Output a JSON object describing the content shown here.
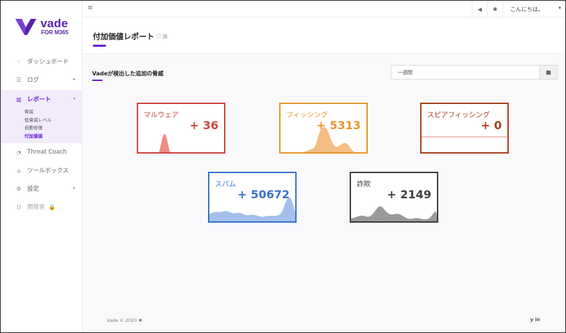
{
  "app": {
    "logo_text": "vade",
    "logo_sub": "FOR M365"
  },
  "topbar": {
    "greeting": "こんにちは。",
    "hamburger_icon": "menu-icon",
    "announce_icon": "megaphone-icon",
    "theme_icon": "sun-icon"
  },
  "sidebar": {
    "items": [
      {
        "label": "ダッシュボード",
        "icon": "grid-icon"
      },
      {
        "label": "ログ",
        "icon": "list-icon"
      },
      {
        "label": "レポート",
        "icon": "chart-icon"
      },
      {
        "label": "Threat Coach",
        "icon": "coach-icon"
      },
      {
        "label": "ツールボックス",
        "icon": "toolbox-icon"
      },
      {
        "label": "設定",
        "icon": "gear-icon"
      },
      {
        "label": "開発者",
        "icon": "code-icon"
      }
    ],
    "report_sub": [
      "脅威",
      "低脅威レベル",
      "自動修復",
      "付加価値"
    ]
  },
  "header": {
    "title": "付加価値レポート"
  },
  "main": {
    "section_title": "Vadeが検出した追加の脅威",
    "period": "一週間"
  },
  "cards": [
    {
      "label": "マルウェア",
      "value": "+ 36",
      "color": "#d0463c"
    },
    {
      "label": "フィッシング",
      "value": "+ 5313",
      "color": "#e9962d"
    },
    {
      "label": "スピアフィッシング",
      "value": "+ 0",
      "color": "#a5401d"
    },
    {
      "label": "スパム",
      "value": "+ 50672",
      "color": "#3973c7"
    },
    {
      "label": "詐欺",
      "value": "+ 2149",
      "color": "#3f3f3f"
    }
  ],
  "footer": {
    "copyright": "Vade © 2023",
    "social": "y in"
  }
}
